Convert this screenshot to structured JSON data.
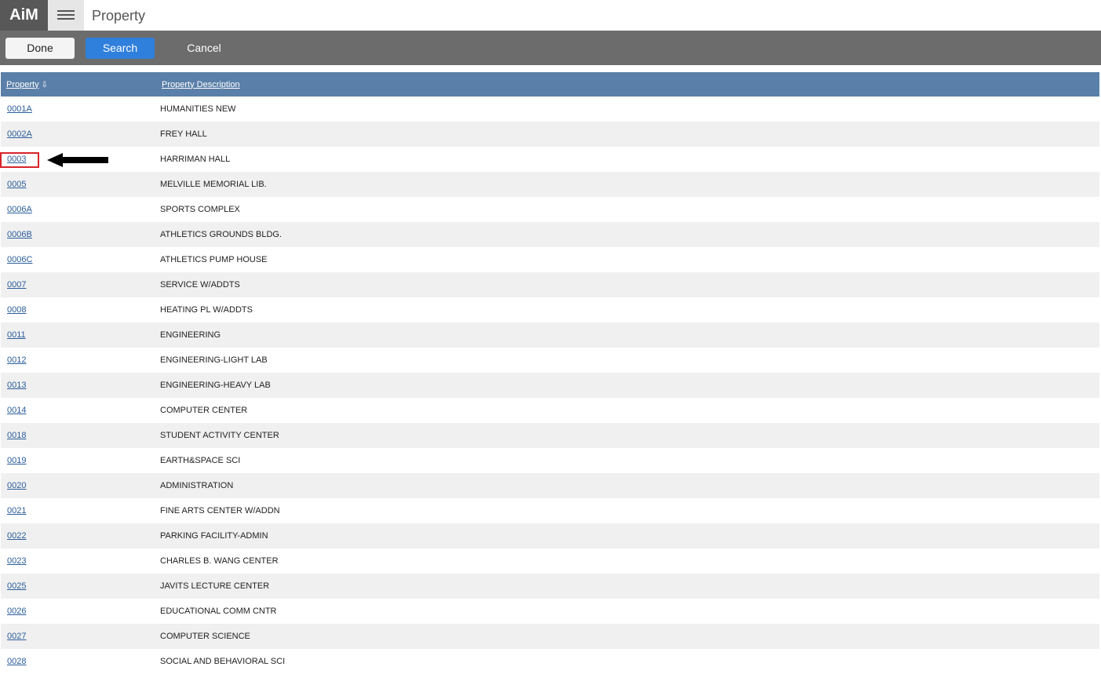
{
  "app": {
    "logo": "AiM",
    "page_title": "Property"
  },
  "toolbar": {
    "done_label": "Done",
    "search_label": "Search",
    "cancel_label": "Cancel"
  },
  "table": {
    "columns": [
      "Property",
      "Property Description"
    ],
    "sort_indicator": "⇩",
    "rows": [
      {
        "property": "0001A",
        "description": "HUMANITIES NEW"
      },
      {
        "property": "0002A",
        "description": "FREY HALL"
      },
      {
        "property": "0003",
        "description": "HARRIMAN HALL"
      },
      {
        "property": "0005",
        "description": "MELVILLE MEMORIAL LIB."
      },
      {
        "property": "0006A",
        "description": "SPORTS COMPLEX"
      },
      {
        "property": "0006B",
        "description": "ATHLETICS GROUNDS BLDG."
      },
      {
        "property": "0006C",
        "description": "ATHLETICS PUMP HOUSE"
      },
      {
        "property": "0007",
        "description": "SERVICE W/ADDTS"
      },
      {
        "property": "0008",
        "description": "HEATING PL W/ADDTS"
      },
      {
        "property": "0011",
        "description": "ENGINEERING"
      },
      {
        "property": "0012",
        "description": "ENGINEERING-LIGHT LAB"
      },
      {
        "property": "0013",
        "description": "ENGINEERING-HEAVY LAB"
      },
      {
        "property": "0014",
        "description": "COMPUTER CENTER"
      },
      {
        "property": "0018",
        "description": "STUDENT ACTIVITY CENTER"
      },
      {
        "property": "0019",
        "description": "EARTH&SPACE SCI"
      },
      {
        "property": "0020",
        "description": "ADMINISTRATION"
      },
      {
        "property": "0021",
        "description": "FINE ARTS CENTER W/ADDN"
      },
      {
        "property": "0022",
        "description": "PARKING FACILITY-ADMIN"
      },
      {
        "property": "0023",
        "description": "CHARLES B. WANG CENTER"
      },
      {
        "property": "0025",
        "description": "JAVITS LECTURE CENTER"
      },
      {
        "property": "0026",
        "description": "EDUCATIONAL COMM CNTR"
      },
      {
        "property": "0027",
        "description": "COMPUTER SCIENCE"
      },
      {
        "property": "0028",
        "description": "SOCIAL AND BEHAVIORAL SCI"
      }
    ]
  },
  "annotation": {
    "highlight_color": "#d8232a",
    "arrow_color": "#000000"
  },
  "colors": {
    "header_bg": "#5a7fa8",
    "toolbar_bg": "#6c6c6c",
    "search_button": "#2f7fdc",
    "link": "#2a5d9a"
  },
  "icons": {
    "menu": "hamburger-menu-icon",
    "sort": "sort-descending-icon"
  }
}
